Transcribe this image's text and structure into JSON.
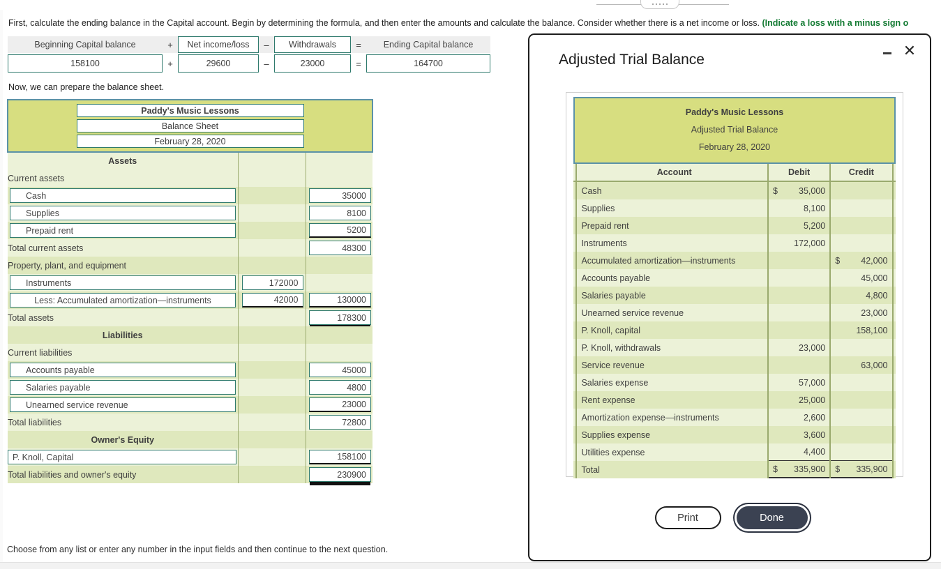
{
  "question": {
    "text_part1": "First, calculate the ending balance in the Capital account. Begin by determining the formula, and then enter the amounts and calculate the balance. Consider whether there is a net income or loss. ",
    "text_green": "(Indicate a loss with a minus sign o",
    "now_text": "Now, we can prepare the balance sheet.",
    "footnote": "Choose from any list or enter any number in the input fields and then continue to the next question."
  },
  "formula": {
    "labels": {
      "beginning": "Beginning Capital balance",
      "op1": "+",
      "net_income": "Net income/loss",
      "op2": "–",
      "withdrawals": "Withdrawals",
      "op3": "=",
      "ending": "Ending Capital balance"
    },
    "values": {
      "beginning": "158100",
      "op1": "+",
      "net_income": "29600",
      "op2": "–",
      "withdrawals": "23000",
      "op3": "=",
      "ending": "164700"
    }
  },
  "balance_sheet": {
    "header": {
      "company": "Paddy's Music Lessons",
      "statement": "Balance Sheet",
      "date": "February 28, 2020"
    },
    "sections": {
      "assets": "Assets",
      "liabilities": "Liabilities",
      "owners_equity": "Owner's Equity"
    },
    "rows": {
      "current_assets": "Current assets",
      "cash": "Cash",
      "cash_amt": "35000",
      "supplies": "Supplies",
      "supplies_amt": "8100",
      "prepaid_rent": "Prepaid rent",
      "prepaid_rent_amt": "5200",
      "total_current_assets": "Total current assets",
      "total_current_assets_amt": "48300",
      "ppe": "Property, plant, and equipment",
      "instruments": "Instruments",
      "instruments_amt": "172000",
      "less_accum": "Less: Accumulated amortization—instruments",
      "less_accum_amt": "42000",
      "net_instruments_amt": "130000",
      "total_assets": "Total assets",
      "total_assets_amt": "178300",
      "current_liabilities": "Current liabilities",
      "accounts_payable": "Accounts payable",
      "accounts_payable_amt": "45000",
      "salaries_payable": "Salaries payable",
      "salaries_payable_amt": "4800",
      "unearned_revenue": "Unearned service revenue",
      "unearned_revenue_amt": "23000",
      "total_liabilities": "Total liabilities",
      "total_liabilities_amt": "72800",
      "knoll_capital": "P. Knoll, Capital",
      "knoll_capital_amt": "158100",
      "total_liab_equity": "Total liabilities and owner's equity",
      "total_liab_equity_amt": "230900"
    }
  },
  "modal": {
    "title": "Adjusted Trial Balance",
    "minimize_label": "",
    "close_label": "✕",
    "header": {
      "company": "Paddy's Music Lessons",
      "statement": "Adjusted Trial Balance",
      "date": "February 28, 2020"
    },
    "columns": {
      "account": "Account",
      "debit": "Debit",
      "credit": "Credit"
    },
    "rows": [
      {
        "account": "Cash",
        "debit_cur": "$",
        "debit": "35,000",
        "credit_cur": "",
        "credit": ""
      },
      {
        "account": "Supplies",
        "debit_cur": "",
        "debit": "8,100",
        "credit_cur": "",
        "credit": ""
      },
      {
        "account": "Prepaid rent",
        "debit_cur": "",
        "debit": "5,200",
        "credit_cur": "",
        "credit": ""
      },
      {
        "account": "Instruments",
        "debit_cur": "",
        "debit": "172,000",
        "credit_cur": "",
        "credit": ""
      },
      {
        "account": "Accumulated amortization—instruments",
        "debit_cur": "",
        "debit": "",
        "credit_cur": "$",
        "credit": "42,000"
      },
      {
        "account": "Accounts payable",
        "debit_cur": "",
        "debit": "",
        "credit_cur": "",
        "credit": "45,000"
      },
      {
        "account": "Salaries payable",
        "debit_cur": "",
        "debit": "",
        "credit_cur": "",
        "credit": "4,800"
      },
      {
        "account": "Unearned service revenue",
        "debit_cur": "",
        "debit": "",
        "credit_cur": "",
        "credit": "23,000"
      },
      {
        "account": "P. Knoll, capital",
        "debit_cur": "",
        "debit": "",
        "credit_cur": "",
        "credit": "158,100"
      },
      {
        "account": "P. Knoll, withdrawals",
        "debit_cur": "",
        "debit": "23,000",
        "credit_cur": "",
        "credit": ""
      },
      {
        "account": "Service revenue",
        "debit_cur": "",
        "debit": "",
        "credit_cur": "",
        "credit": "63,000"
      },
      {
        "account": "Salaries expense",
        "debit_cur": "",
        "debit": "57,000",
        "credit_cur": "",
        "credit": ""
      },
      {
        "account": "Rent expense",
        "debit_cur": "",
        "debit": "25,000",
        "credit_cur": "",
        "credit": ""
      },
      {
        "account": "Amortization expense—instruments",
        "debit_cur": "",
        "debit": "2,600",
        "credit_cur": "",
        "credit": ""
      },
      {
        "account": "Supplies expense",
        "debit_cur": "",
        "debit": "3,600",
        "credit_cur": "",
        "credit": ""
      },
      {
        "account": "Utilities expense",
        "debit_cur": "",
        "debit": "4,400",
        "credit_cur": "",
        "credit": "",
        "rule": "single"
      },
      {
        "account": "Total",
        "debit_cur": "$",
        "debit": "335,900",
        "credit_cur": "$",
        "credit": "335,900",
        "rule": "double"
      }
    ],
    "buttons": {
      "print": "Print",
      "done": "Done"
    }
  },
  "colors": {
    "header_green": "#d7de80",
    "header_border": "#5b92a8",
    "row_dark": "#dfe8bd",
    "row_light": "#ecf2d8",
    "input_border": "#2f7a6d",
    "accent_green_text": "#127a32",
    "done_button": "#3b4252"
  }
}
